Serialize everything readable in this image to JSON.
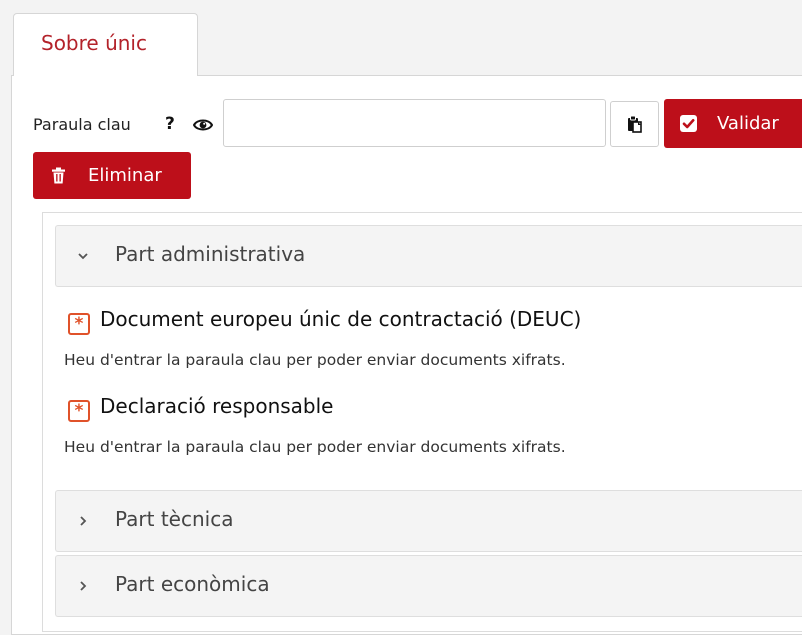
{
  "tab": {
    "label": "Sobre únic"
  },
  "password": {
    "label": "Paraula clau",
    "help": "?",
    "value": "",
    "placeholder": ""
  },
  "buttons": {
    "validar": "Validar",
    "eliminar": "Eliminar"
  },
  "sections": [
    {
      "title": "Part administrativa",
      "expanded": true,
      "documents": [
        {
          "title": "Document europeu únic de contractació (DEUC)",
          "note": "Heu d'entrar la paraula clau per poder enviar documents xifrats."
        },
        {
          "title": "Declaració responsable",
          "note": "Heu d'entrar la paraula clau per poder enviar documents xifrats."
        }
      ]
    },
    {
      "title": "Part tècnica",
      "expanded": false
    },
    {
      "title": "Part econòmica",
      "expanded": false
    }
  ],
  "colors": {
    "primary": "#bd0f1a",
    "required": "#e0522a",
    "tab_text": "#b3222a"
  },
  "icons": {
    "password_visibility": "eye-icon",
    "paste": "clipboard-icon",
    "validar": "check-square-icon",
    "eliminar": "trash-icon",
    "expanded": "chevron-down-icon",
    "collapsed": "chevron-right-icon",
    "required": "asterisk-icon"
  }
}
